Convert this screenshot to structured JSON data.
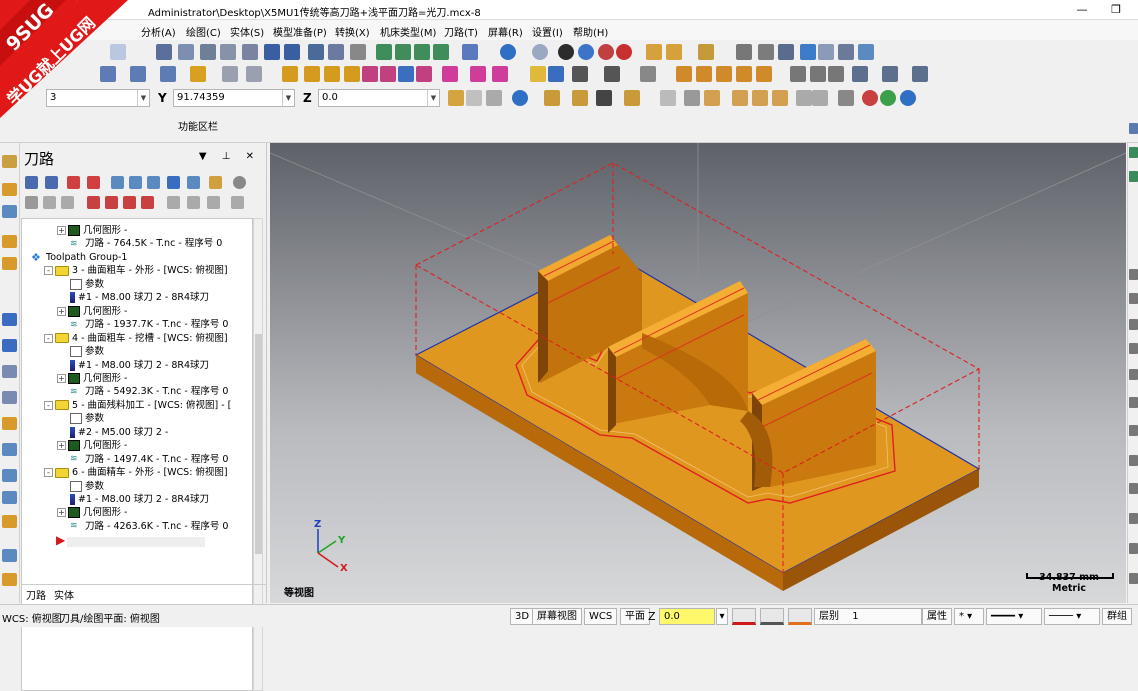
{
  "titlebar": {
    "title": "Administrator\\Desktop\\X5MU1传统等高刀路+浅平面刀路=光刀.mcx-8"
  },
  "watermark": {
    "line1": "9SUG",
    "line2": "学UG就上UG网"
  },
  "menu": [
    "分析(A)",
    "绘图(C)",
    "实体(S)",
    "模型准备(P)",
    "转换(X)",
    "机床类型(M)",
    "刀路(T)",
    "屏幕(R)",
    "设置(I)",
    "帮助(H)"
  ],
  "coords": {
    "x_value": "3",
    "y_label": "Y",
    "y_value": "91.74359",
    "z_label": "Z",
    "z_value": "0.0"
  },
  "ribbon_label": "功能区栏",
  "panel": {
    "title": "刀路",
    "tree": [
      {
        "indent": 3,
        "expander": "+",
        "icon": "geom",
        "text": "几何图形 -"
      },
      {
        "indent": 4,
        "icon": "path",
        "text": "刀路 - 764.5K - T.nc - 程序号 0"
      },
      {
        "indent": 1,
        "icon": "group",
        "text": "Toolpath Group-1"
      },
      {
        "indent": 2,
        "expander": "-",
        "icon": "folder",
        "text": "3 - 曲面粗车 - 外形 - [WCS: 俯视图]"
      },
      {
        "indent": 4,
        "icon": "param",
        "text": "参数"
      },
      {
        "indent": 4,
        "icon": "tool",
        "text": "#1 - M8.00 球刀 2 - 8R4球刀"
      },
      {
        "indent": 3,
        "expander": "+",
        "icon": "geom",
        "text": "几何图形 -"
      },
      {
        "indent": 4,
        "icon": "path",
        "text": "刀路 - 1937.7K - T.nc - 程序号 0"
      },
      {
        "indent": 2,
        "expander": "-",
        "icon": "folder",
        "text": "4 - 曲面粗车 - 挖槽 - [WCS: 俯视图]"
      },
      {
        "indent": 4,
        "icon": "param",
        "text": "参数"
      },
      {
        "indent": 4,
        "icon": "tool",
        "text": "#1 - M8.00 球刀 2 - 8R4球刀"
      },
      {
        "indent": 3,
        "expander": "+",
        "icon": "geom",
        "text": "几何图形 -"
      },
      {
        "indent": 4,
        "icon": "path",
        "text": "刀路 - 5492.3K - T.nc - 程序号 0"
      },
      {
        "indent": 2,
        "expander": "-",
        "icon": "folder",
        "text": "5 - 曲面残料加工 - [WCS: 俯视图] - ["
      },
      {
        "indent": 4,
        "icon": "param",
        "text": "参数"
      },
      {
        "indent": 4,
        "icon": "tool",
        "text": "#2 - M5.00 球刀 2 -"
      },
      {
        "indent": 3,
        "expander": "+",
        "icon": "geom",
        "text": "几何图形 -"
      },
      {
        "indent": 4,
        "icon": "path",
        "text": "刀路 - 1497.4K - T.nc - 程序号 0"
      },
      {
        "indent": 2,
        "expander": "-",
        "icon": "folder",
        "text": "6 - 曲面精车 - 外形 - [WCS: 俯视图]"
      },
      {
        "indent": 4,
        "icon": "param",
        "text": "参数"
      },
      {
        "indent": 4,
        "icon": "tool",
        "text": "#1 - M8.00 球刀 2 - 8R4球刀"
      },
      {
        "indent": 3,
        "expander": "+",
        "icon": "geom",
        "text": "几何图形 -"
      },
      {
        "indent": 4,
        "icon": "path",
        "text": "刀路 - 4263.6K - T.nc - 程序号 0"
      }
    ],
    "tabs": [
      "刀路",
      "实体"
    ]
  },
  "viewport": {
    "view_name": "等视图",
    "scale_value": "34.837 mm",
    "scale_unit": "Metric",
    "axis_z": "Z",
    "axis_y": "Y",
    "axis_x": "X",
    "colors": {
      "part": "#d98a16",
      "part_dark": "#8a4d08",
      "boundary": "#e02020",
      "stock_edge": "#2233aa"
    }
  },
  "statusbar": {
    "wcs": "WCS: 俯视图",
    "tool_plane": "刀具/绘图平面: 俯视图",
    "btn_3d": "3D",
    "btn_screen_view": "屏幕视图",
    "btn_wcs": "WCS",
    "btn_plane": "平面",
    "z_label": "Z",
    "z_value": "0.0",
    "layer_label": "层别",
    "layer_value": "1",
    "attr_label": "属性",
    "group_label": "群组"
  }
}
